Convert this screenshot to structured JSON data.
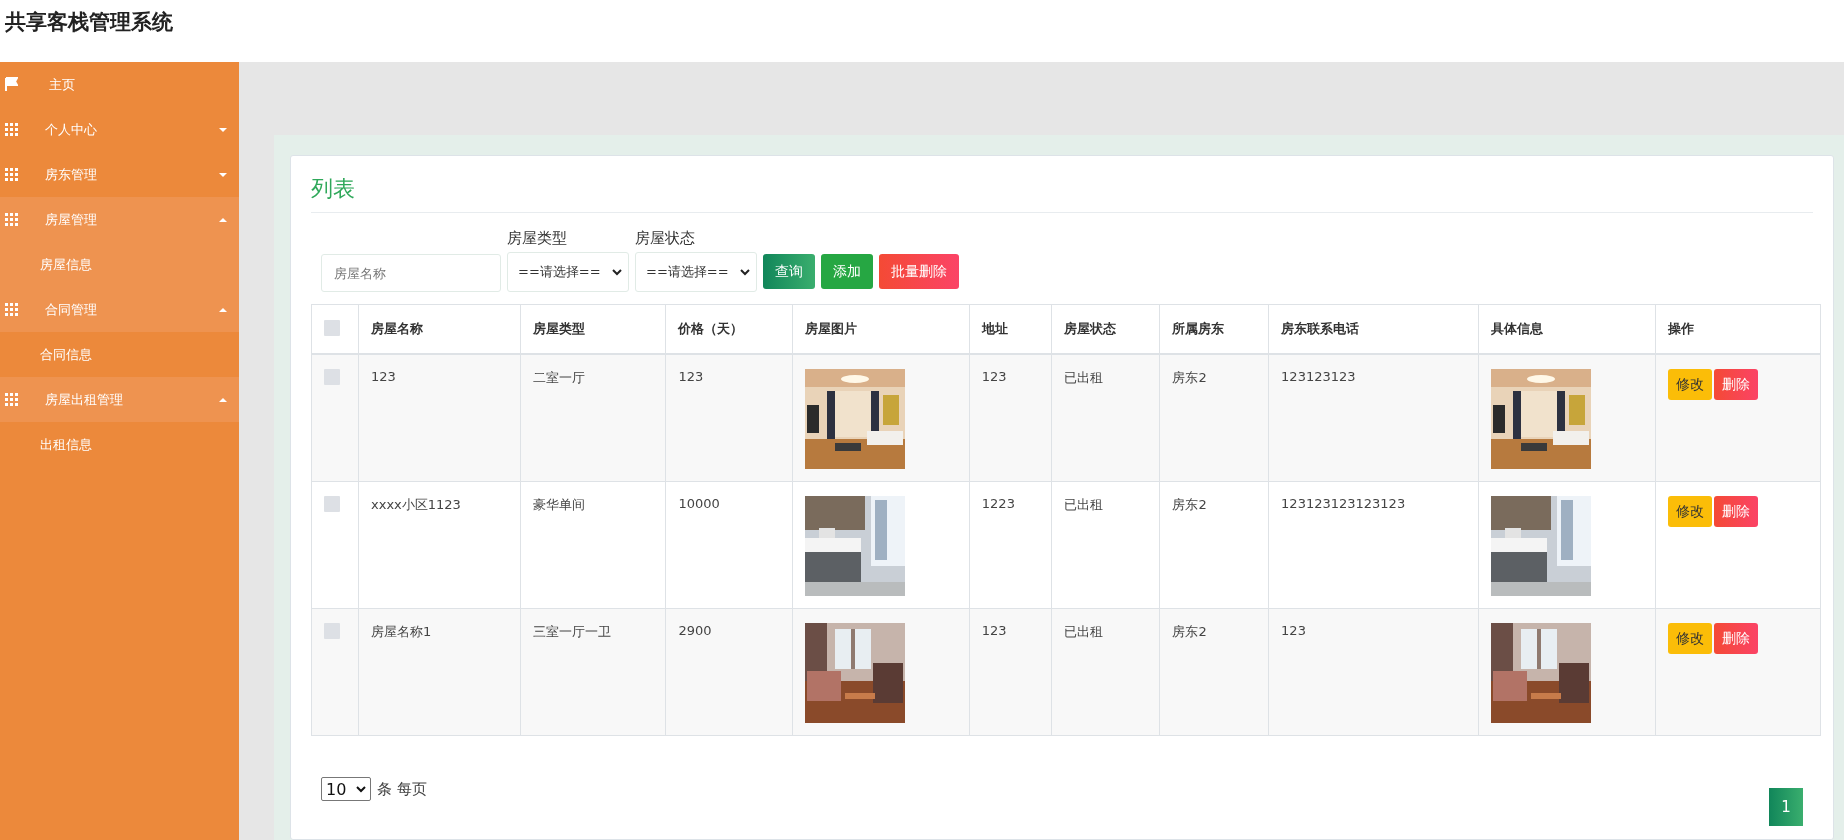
{
  "app_title": "共享客栈管理系统",
  "sidebar": {
    "items": [
      {
        "label": "主页",
        "kind": "link"
      },
      {
        "label": "个人中心",
        "kind": "group",
        "expanded": false
      },
      {
        "label": "房东管理",
        "kind": "group",
        "expanded": false
      },
      {
        "label": "房屋管理",
        "kind": "group",
        "expanded": true,
        "children": [
          {
            "label": "房屋信息",
            "selected": true
          }
        ]
      },
      {
        "label": "合同管理",
        "kind": "group",
        "expanded": true,
        "children": [
          {
            "label": "合同信息",
            "selected": false
          }
        ]
      },
      {
        "label": "房屋出租管理",
        "kind": "group",
        "expanded": true,
        "children": [
          {
            "label": "出租信息",
            "selected": false
          }
        ]
      }
    ]
  },
  "panel": {
    "title": "列表",
    "filters": [
      {
        "kind": "text",
        "placeholder": "房屋名称"
      },
      {
        "kind": "select",
        "label": "房屋类型",
        "value": "==请选择=="
      },
      {
        "kind": "select",
        "label": "房屋状态",
        "value": "==请选择=="
      }
    ],
    "buttons": [
      {
        "label": "查询",
        "kind": "search"
      },
      {
        "label": "添加",
        "kind": "add"
      },
      {
        "label": "批量删除",
        "kind": "delete"
      }
    ],
    "table": {
      "all_selected": false,
      "columns": [
        "房屋名称",
        "房屋类型",
        "价格（天）",
        "房屋图片",
        "地址",
        "房屋状态",
        "所属房东",
        "房东联系电话",
        "具体信息",
        "操作"
      ],
      "rows": [
        {
          "selected": false,
          "name": "123",
          "type": "二室一厅",
          "price": "123",
          "address": "123",
          "status": "已出租",
          "landlord": "房东2",
          "phone": "123123123",
          "actions": [
            "修改",
            "删除"
          ]
        },
        {
          "selected": false,
          "name": "xxxx小区1123",
          "type": "豪华单间",
          "price": "10000",
          "address": "1223",
          "status": "已出租",
          "landlord": "房东2",
          "phone": "123123123123123",
          "actions": [
            "修改",
            "删除"
          ]
        },
        {
          "selected": false,
          "name": "房屋名称1",
          "type": "三室一厅一卫",
          "price": "2900",
          "address": "123",
          "status": "已出租",
          "landlord": "房东2",
          "phone": "123",
          "actions": [
            "修改",
            "删除"
          ]
        }
      ]
    },
    "pagination": {
      "page_size": "10",
      "page_size_label": "条 每页",
      "pages": [
        {
          "label": "1",
          "selected": true
        }
      ]
    }
  }
}
